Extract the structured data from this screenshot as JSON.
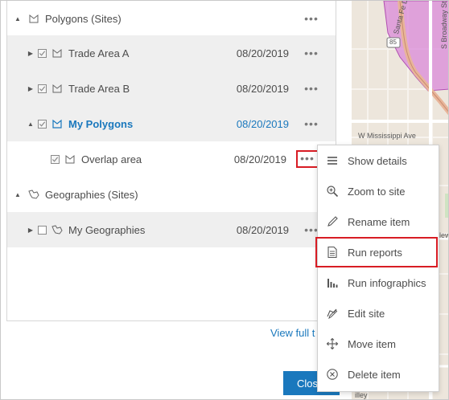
{
  "tree": {
    "rows": [
      {
        "label": "Polygons (Sites)",
        "date": "",
        "shaded": false
      },
      {
        "label": "Trade Area A",
        "date": "08/20/2019",
        "shaded": true
      },
      {
        "label": "Trade Area B",
        "date": "08/20/2019",
        "shaded": true
      },
      {
        "label": "My Polygons",
        "date": "08/20/2019",
        "shaded": true
      },
      {
        "label": "Overlap area",
        "date": "08/20/2019",
        "shaded": false
      },
      {
        "label": "Geographies (Sites)",
        "date": "",
        "shaded": false
      },
      {
        "label": "My Geographies",
        "date": "08/20/2019",
        "shaded": true
      }
    ],
    "more_glyph": "•••"
  },
  "footer": {
    "view_full_label": "View full t",
    "close_label": "Clos"
  },
  "context_menu": {
    "items": [
      {
        "label": "Show details",
        "icon": "list-icon"
      },
      {
        "label": "Zoom to site",
        "icon": "zoom-in-icon"
      },
      {
        "label": "Rename item",
        "icon": "pencil-icon"
      },
      {
        "label": "Run reports",
        "icon": "document-icon",
        "highlighted": true
      },
      {
        "label": "Run infographics",
        "icon": "bar-chart-icon"
      },
      {
        "label": "Edit site",
        "icon": "edit-shape-icon"
      },
      {
        "label": "Move item",
        "icon": "move-arrows-icon"
      },
      {
        "label": "Delete item",
        "icon": "delete-circle-icon"
      }
    ]
  },
  "map": {
    "labels": {
      "santa_fe": "Santa Fe Dr",
      "broadway": "S Broadway St",
      "mississippi": "W Mississippi Ave",
      "route": "85",
      "ewood": "ewood",
      "glew": "glew",
      "illey": "illey"
    },
    "colors": {
      "base": "#ede6dc",
      "purple_zone": "#d98ad9",
      "highway": "#e8b59a",
      "road": "#ffffff"
    }
  },
  "colors": {
    "accent": "#1a78bd",
    "highlight": "#d81c24"
  }
}
